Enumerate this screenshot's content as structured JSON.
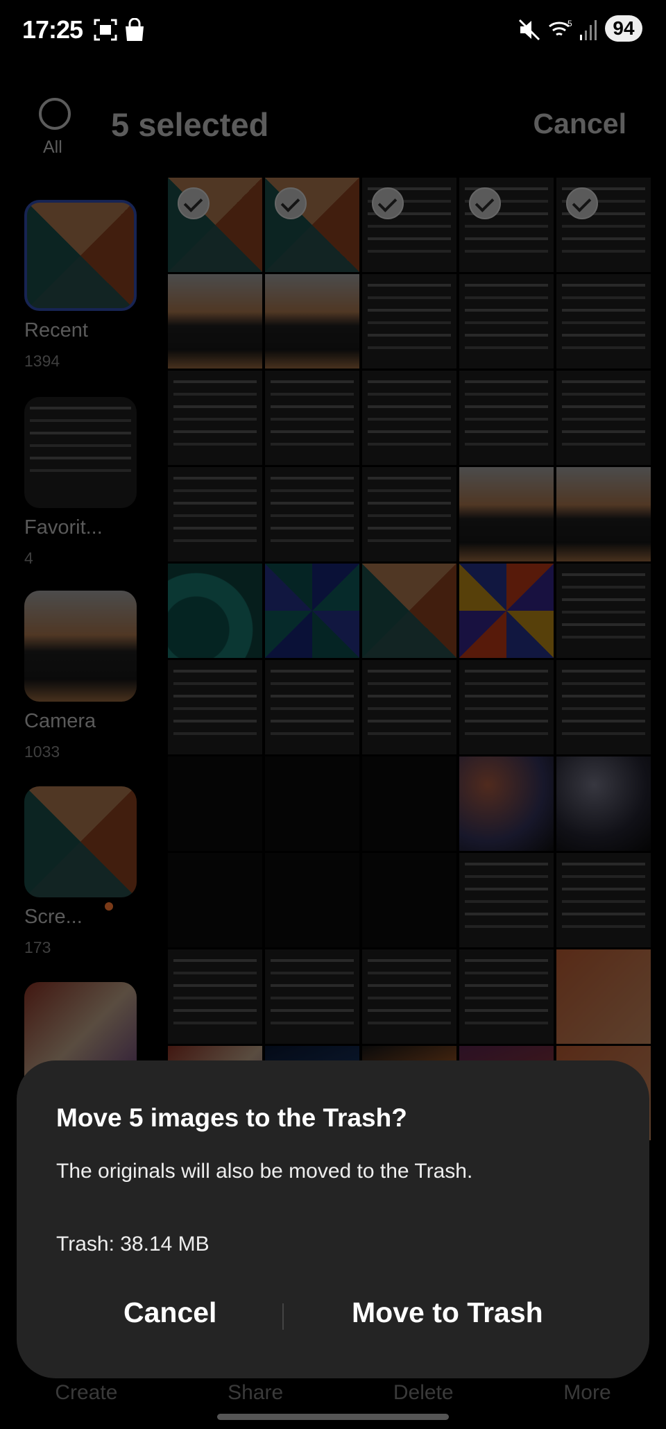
{
  "status_bar": {
    "time": "17:25",
    "battery": "94",
    "icons": [
      "screenshot-icon",
      "shopping-bag-icon",
      "mute-icon",
      "wifi-icon",
      "signal-icon"
    ]
  },
  "header": {
    "select_all_label": "All",
    "title": "5 selected",
    "cancel_label": "Cancel"
  },
  "albums": [
    {
      "name": "Recent",
      "count": "1394",
      "thumb": "wp"
    },
    {
      "name": "Favorit...",
      "count": "4",
      "thumb": "dark"
    },
    {
      "name": "Camera",
      "count": "1033",
      "thumb": "photo"
    },
    {
      "name": "Scre...",
      "count": "173",
      "thumb": "wp"
    },
    {
      "name": "",
      "count": "",
      "thumb": "colorful"
    }
  ],
  "grid": {
    "tiles": [
      "wp",
      "wp",
      "dark",
      "dark",
      "dark",
      "photo",
      "photo",
      "dark",
      "dark",
      "dark",
      "dark",
      "dark",
      "dark",
      "dark",
      "dark",
      "dark",
      "dark",
      "dark",
      "photo",
      "photo",
      "teal",
      "bluepin",
      "wp",
      "rainbow",
      "dark",
      "dark",
      "dark",
      "dark",
      "dark",
      "dark",
      "black",
      "black",
      "black",
      "blur",
      "blur2",
      "black",
      "black",
      "black",
      "dark",
      "dark",
      "dark",
      "dark",
      "dark",
      "dark",
      "orange",
      "colorful",
      "bluegrad",
      "warm",
      "purple",
      "orange"
    ],
    "selected": [
      0,
      1,
      2,
      3,
      4
    ]
  },
  "bottom_nav": [
    "Create",
    "Share",
    "Delete",
    "More"
  ],
  "dialog": {
    "title": "Move 5 images to the Trash?",
    "body": "The originals will also be moved to the Trash.",
    "trash_size": "Trash: 38.14 MB",
    "cancel_label": "Cancel",
    "confirm_label": "Move to Trash"
  }
}
